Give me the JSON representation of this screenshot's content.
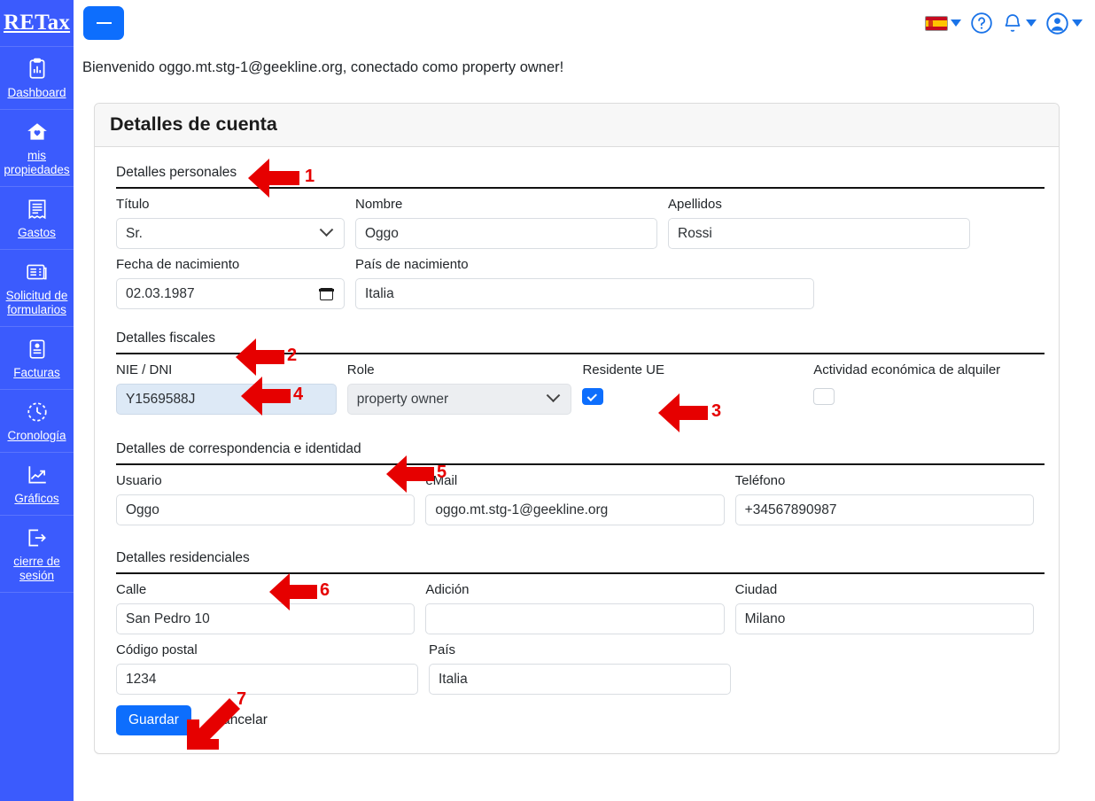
{
  "app": {
    "brand": "RETax"
  },
  "sidebar": {
    "items": [
      {
        "label": "Dashboard",
        "icon": "dashboard-icon"
      },
      {
        "label": "mis propiedades",
        "icon": "home-icon"
      },
      {
        "label": "Gastos",
        "icon": "receipt-icon"
      },
      {
        "label": "Solicitud de formularios",
        "icon": "form-request-icon"
      },
      {
        "label": "Facturas",
        "icon": "invoice-icon"
      },
      {
        "label": "Cronología",
        "icon": "clock-icon"
      },
      {
        "label": "Gráficos",
        "icon": "chart-line-icon"
      },
      {
        "label": "cierre de sesión",
        "icon": "logout-icon"
      }
    ]
  },
  "topbar": {
    "menu_button": "menu-toggle",
    "language": "Español",
    "help": "?",
    "icons": [
      "flag-es-icon",
      "chevron-down-icon",
      "help-circle-icon",
      "bell-icon",
      "chevron-down-icon",
      "user-circle-icon",
      "chevron-down-icon"
    ]
  },
  "main": {
    "welcome": "Bienvenido oggo.mt.stg-1@geekline.org, conectado como property owner!",
    "card_title": "Detalles de cuenta"
  },
  "sections": {
    "personal": {
      "legend": "Detalles personales"
    },
    "fiscal": {
      "legend": "Detalles fiscales"
    },
    "correspondence": {
      "legend": "Detalles de correspondencia e identidad"
    },
    "residential": {
      "legend": "Detalles residenciales"
    }
  },
  "fields": {
    "titulo": {
      "label": "Título",
      "value": "Sr."
    },
    "nombre": {
      "label": "Nombre",
      "value": "Oggo"
    },
    "apellidos": {
      "label": "Apellidos",
      "value": "Rossi"
    },
    "fecha_nac": {
      "label": "Fecha de nacimiento",
      "value": "02.03.1987"
    },
    "pais_nac": {
      "label": "País de nacimiento",
      "value": "Italia"
    },
    "nie_dni": {
      "label": "NIE / DNI",
      "value": "Y1569588J"
    },
    "role": {
      "label": "Role",
      "value": "property owner"
    },
    "residente_ue": {
      "label": "Residente UE",
      "checked": true
    },
    "actividad": {
      "label": "Actividad económica de alquiler",
      "checked": false
    },
    "usuario": {
      "label": "Usuario",
      "value": "Oggo"
    },
    "email": {
      "label": "eMail",
      "value": "oggo.mt.stg-1@geekline.org"
    },
    "telefono": {
      "label": "Teléfono",
      "value": "+34567890987"
    },
    "calle": {
      "label": "Calle",
      "value": "San Pedro 10"
    },
    "adicion": {
      "label": "Adición",
      "value": ""
    },
    "ciudad": {
      "label": "Ciudad",
      "value": "Milano"
    },
    "cp": {
      "label": "Código postal",
      "value": "1234"
    },
    "pais": {
      "label": "País",
      "value": "Italia"
    }
  },
  "buttons": {
    "save": "Guardar",
    "cancel": "Cancelar"
  },
  "annotations": [
    {
      "n": "1"
    },
    {
      "n": "2"
    },
    {
      "n": "3"
    },
    {
      "n": "4"
    },
    {
      "n": "5"
    },
    {
      "n": "6"
    },
    {
      "n": "7"
    }
  ],
  "colors": {
    "accent": "#0d6efd",
    "sidebar": "#3b5bfd",
    "annotation": "#e60000"
  }
}
